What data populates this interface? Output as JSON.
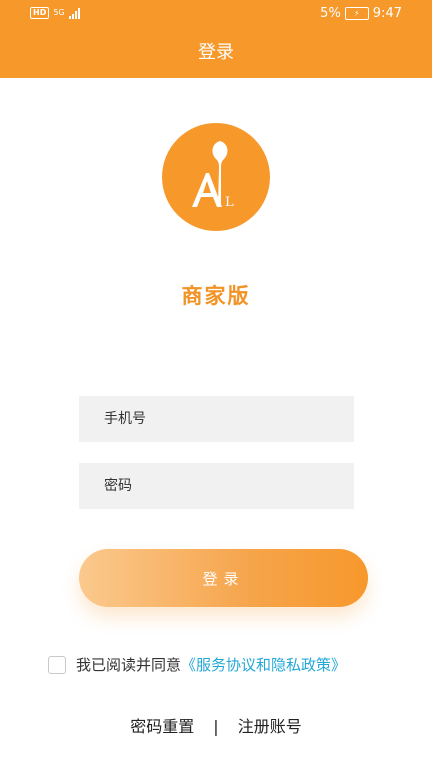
{
  "status_bar": {
    "network_badge": "HD",
    "network_type": "5G",
    "battery": "5%",
    "time": "9:47"
  },
  "header": {
    "title": "登录"
  },
  "logo": {
    "letters": "AG L"
  },
  "edition_label": "商家版",
  "form": {
    "phone_placeholder": "手机号",
    "password_placeholder": "密码",
    "login_label": "登录"
  },
  "agreement": {
    "prefix": "我已阅读并同意",
    "link": "《服务协议和隐私政策》"
  },
  "footer": {
    "reset_password": "密码重置",
    "separator": "|",
    "register": "注册账号"
  },
  "colors": {
    "brand": "#f7982b",
    "link": "#24a8d6",
    "field_bg": "#f1f1f1"
  }
}
